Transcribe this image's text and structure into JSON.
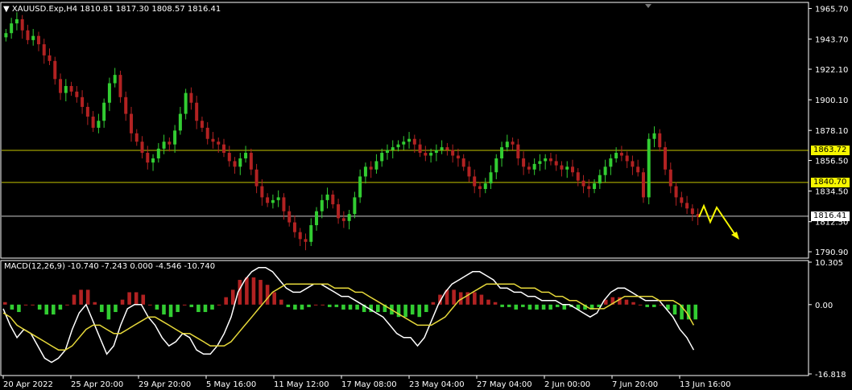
{
  "header": {
    "symbol_line": "XAUUSD.Exp,H4  1810.81 1817.30 1808.57 1816.41",
    "macd_line": "MACD(12,26,9) -10.740 -7.243 0.000 -4.546 -10.740"
  },
  "price_axis": {
    "ticks": [
      "1965.70",
      "1943.70",
      "1922.10",
      "1900.10",
      "1878.10",
      "1856.50",
      "1834.50",
      "1812.50",
      "1790.90"
    ],
    "tick_values": [
      1965.7,
      1943.7,
      1922.1,
      1900.1,
      1878.1,
      1856.5,
      1834.5,
      1812.5,
      1790.9
    ],
    "ylim": [
      1786.9,
      1969.5
    ]
  },
  "macd_axis": {
    "ticks": [
      "10.305",
      "0.00",
      "-16.818"
    ],
    "tick_values": [
      10.305,
      0.0,
      -16.818
    ],
    "ylim": [
      -16.818,
      10.305
    ]
  },
  "time_axis": {
    "labels": [
      "20 Apr 2022",
      "25 Apr 20:00",
      "29 Apr 20:00",
      "5 May 16:00",
      "11 May 12:00",
      "17 May 08:00",
      "23 May 04:00",
      "27 May 04:00",
      "2 Jun 00:00",
      "7 Jun 20:00",
      "13 Jun 16:00"
    ]
  },
  "levels": [
    {
      "label": "1863.72",
      "value": 1863.72,
      "color": "#f7f700"
    },
    {
      "label": "1840.70",
      "value": 1840.7,
      "color": "#f7f700"
    },
    {
      "label": "1816.41",
      "value": 1816.41,
      "color": "#ffffff"
    }
  ],
  "colors": {
    "bull": "#32cd32",
    "bear": "#b22222",
    "macd_main": "#ffffff",
    "macd_signal": "#e6d83a",
    "arrow": "#f7f700"
  },
  "chart_data": {
    "type": "candlestick",
    "title": "XAUUSD.Exp,H4",
    "close_series": [
      1948,
      1955,
      1958,
      1950,
      1943,
      1946,
      1940,
      1932,
      1928,
      1915,
      1905,
      1910,
      1906,
      1902,
      1895,
      1888,
      1880,
      1885,
      1898,
      1912,
      1918,
      1902,
      1890,
      1876,
      1870,
      1862,
      1855,
      1858,
      1865,
      1870,
      1868,
      1878,
      1890,
      1905,
      1898,
      1885,
      1880,
      1872,
      1870,
      1868,
      1862,
      1856,
      1852,
      1858,
      1862,
      1850,
      1838,
      1830,
      1826,
      1828,
      1830,
      1820,
      1812,
      1805,
      1800,
      1798,
      1810,
      1820,
      1828,
      1832,
      1825,
      1815,
      1813,
      1818,
      1830,
      1845,
      1852,
      1850,
      1856,
      1862,
      1864,
      1866,
      1868,
      1870,
      1872,
      1868,
      1862,
      1860,
      1862,
      1864,
      1866,
      1864,
      1860,
      1858,
      1852,
      1845,
      1838,
      1836,
      1840,
      1848,
      1858,
      1866,
      1870,
      1868,
      1858,
      1852,
      1850,
      1854,
      1856,
      1858,
      1856,
      1853,
      1850,
      1852,
      1848,
      1842,
      1838,
      1836,
      1840,
      1846,
      1852,
      1858,
      1862,
      1860,
      1856,
      1852,
      1848,
      1830,
      1872,
      1876,
      1866,
      1850,
      1838,
      1830,
      1826,
      1822,
      1818,
      1816
    ],
    "macd_main": [
      -1,
      -5,
      -8,
      -6,
      -7,
      -10,
      -13,
      -14,
      -13,
      -11,
      -6,
      -2,
      0,
      -4,
      -8,
      -12,
      -10,
      -5,
      -1,
      0,
      0,
      -3,
      -5,
      -8,
      -10,
      -9,
      -7,
      -8,
      -11,
      -12,
      -12,
      -10,
      -7,
      -3,
      3,
      6,
      8,
      9,
      9,
      8,
      6,
      4,
      3,
      3,
      4,
      5,
      5,
      4,
      3,
      2,
      2,
      1,
      0,
      -1,
      -2,
      -3,
      -5,
      -7,
      -8,
      -8,
      -10,
      -8,
      -4,
      0,
      3,
      5,
      6,
      7,
      8,
      8,
      7,
      6,
      4,
      4,
      3,
      3,
      2,
      2,
      1,
      1,
      1,
      0,
      0,
      -1,
      -2,
      -3,
      -2,
      1,
      3,
      4,
      4,
      3,
      2,
      1,
      1,
      1,
      -1,
      -3,
      -6,
      -8,
      -11
    ],
    "macd_signal": [
      -2,
      -3,
      -5,
      -6,
      -7,
      -8,
      -9,
      -10,
      -11,
      -11,
      -10,
      -8,
      -6,
      -5,
      -5,
      -6,
      -7,
      -7,
      -6,
      -5,
      -4,
      -3,
      -3,
      -4,
      -5,
      -6,
      -7,
      -7,
      -8,
      -9,
      -10,
      -10,
      -10,
      -9,
      -7,
      -5,
      -3,
      -1,
      1,
      3,
      4,
      5,
      5,
      5,
      5,
      5,
      5,
      5,
      4,
      4,
      4,
      3,
      3,
      2,
      1,
      0,
      -1,
      -2,
      -3,
      -4,
      -5,
      -5,
      -5,
      -4,
      -3,
      -1,
      1,
      2,
      3,
      4,
      5,
      5,
      5,
      5,
      5,
      4,
      4,
      4,
      3,
      3,
      2,
      2,
      1,
      1,
      0,
      -1,
      -1,
      -1,
      0,
      1,
      2,
      2,
      2,
      2,
      2,
      1,
      1,
      1,
      0,
      -2,
      -5
    ]
  }
}
